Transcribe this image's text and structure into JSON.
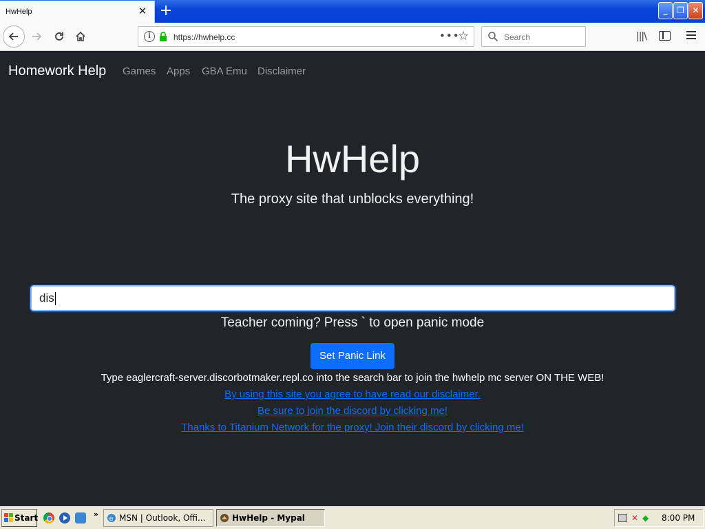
{
  "browser": {
    "tab_title": "HwHelp",
    "tab_close": "✕",
    "new_tab": "+",
    "url": "https://hwhelp.cc",
    "search_placeholder": "Search",
    "url_menu": "•••",
    "window_min": "_",
    "window_max": "❐",
    "window_close": "✕"
  },
  "site": {
    "brand": "Homework Help",
    "nav": [
      "Games",
      "Apps",
      "GBA Emu",
      "Disclaimer"
    ],
    "hero_title": "HwHelp",
    "hero_subtitle": "The proxy site that unblocks everything!",
    "search_value": "dis",
    "panic_text": "Teacher coming? Press ` to open panic mode",
    "panic_button": "Set Panic Link",
    "info_text": "Type eaglercraft-server.discorbotmaker.repl.co into the search bar to join the hwhelp mc server ON THE WEB!",
    "links": [
      "By using this site you agree to have read our disclaimer.",
      "Be sure to join the discord by clicking me!",
      "Thanks to Titanium Network for the proxy! Join their discord by clicking me!"
    ]
  },
  "taskbar": {
    "start": "Start",
    "more": "»",
    "tasks": [
      "MSN | Outlook, Offi...",
      "HwHelp - Mypal"
    ],
    "clock": "8:00 PM"
  },
  "colors": {
    "page_bg": "#212529",
    "accent": "#0d6efd",
    "nav_link": "#9a9da0"
  }
}
